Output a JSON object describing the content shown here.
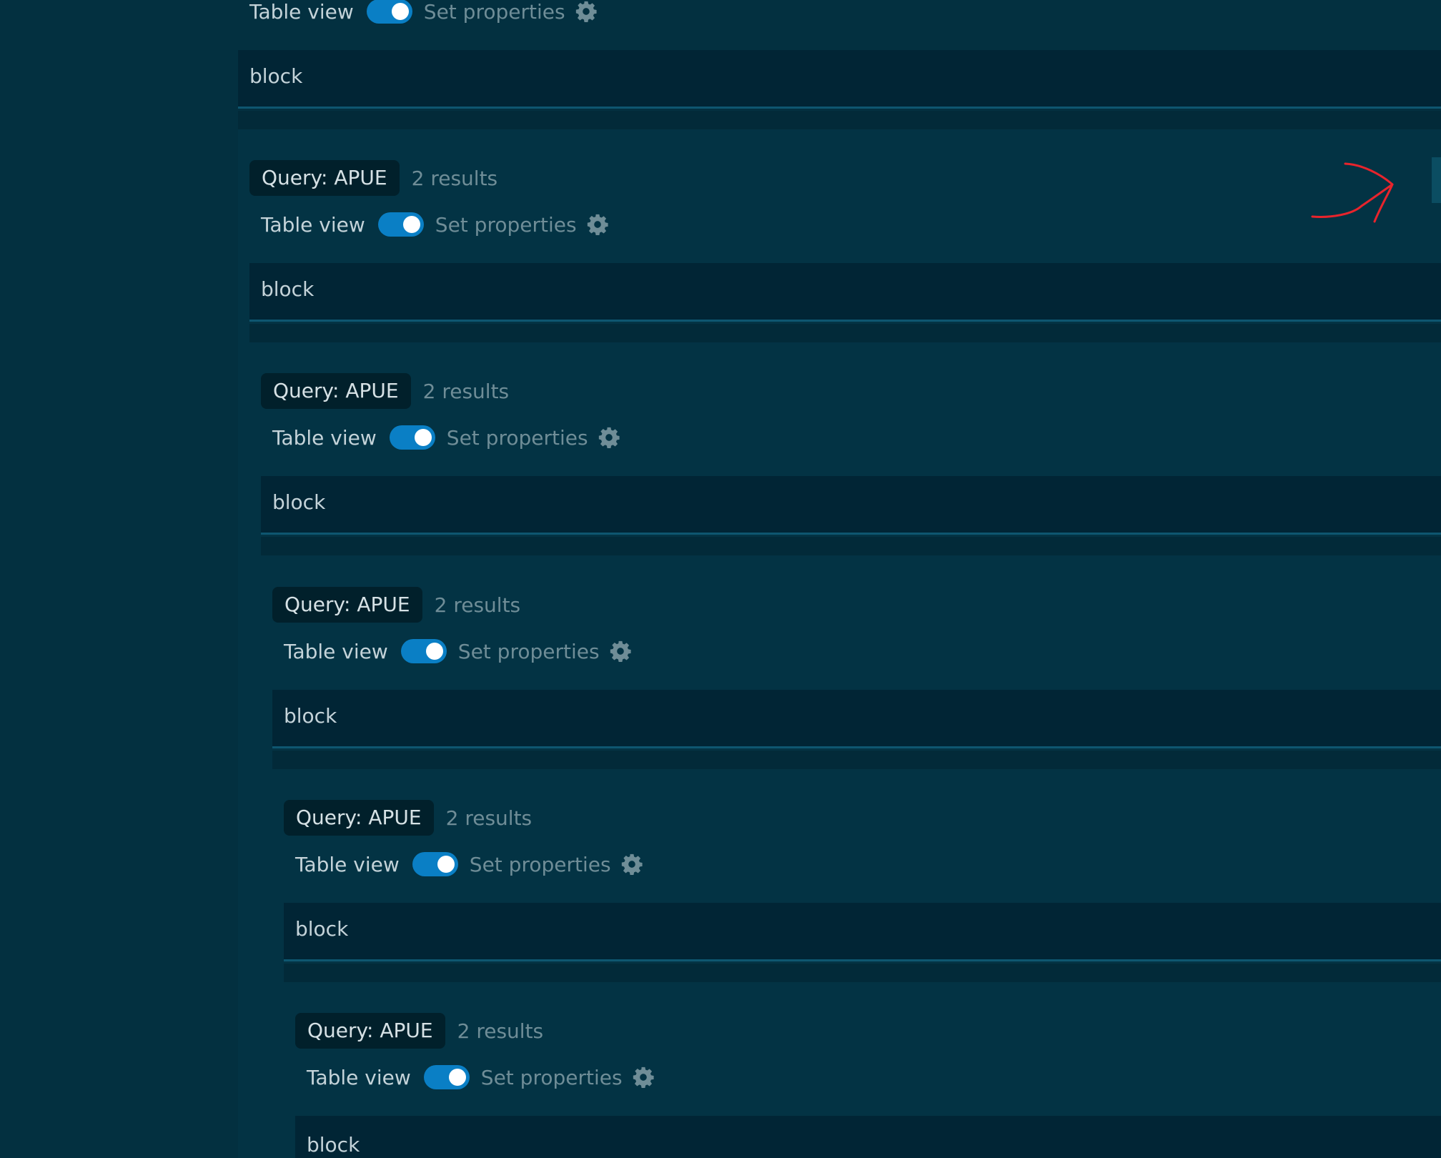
{
  "colors": {
    "background": "#022b3a",
    "panel": "#033040",
    "block_background": "#012535",
    "badge_background": "#01202b",
    "toggle_on": "#0a7fc5",
    "muted_text": "#6f8d97",
    "text": "#c4d3d9",
    "annotation": "#e8242c"
  },
  "icons": {
    "settings": "gear-icon",
    "annotation": "red-arrow-annotation"
  },
  "top": {
    "table_view_label": "Table view",
    "table_view_on": true,
    "set_properties_label": "Set properties",
    "block_text": "block"
  },
  "queries": [
    {
      "query_label": "Query: APUE",
      "results_label": "2 results",
      "table_view_label": "Table view",
      "table_view_on": true,
      "set_properties_label": "Set properties",
      "block_text": "block"
    },
    {
      "query_label": "Query: APUE",
      "results_label": "2 results",
      "table_view_label": "Table view",
      "table_view_on": true,
      "set_properties_label": "Set properties",
      "block_text": "block"
    },
    {
      "query_label": "Query: APUE",
      "results_label": "2 results",
      "table_view_label": "Table view",
      "table_view_on": true,
      "set_properties_label": "Set properties",
      "block_text": "block"
    },
    {
      "query_label": "Query: APUE",
      "results_label": "2 results",
      "table_view_label": "Table view",
      "table_view_on": true,
      "set_properties_label": "Set properties",
      "block_text": "block"
    },
    {
      "query_label": "Query: APUE",
      "results_label": "2 results",
      "table_view_label": "Table view",
      "table_view_on": true,
      "set_properties_label": "Set properties",
      "block_text": "block"
    }
  ]
}
